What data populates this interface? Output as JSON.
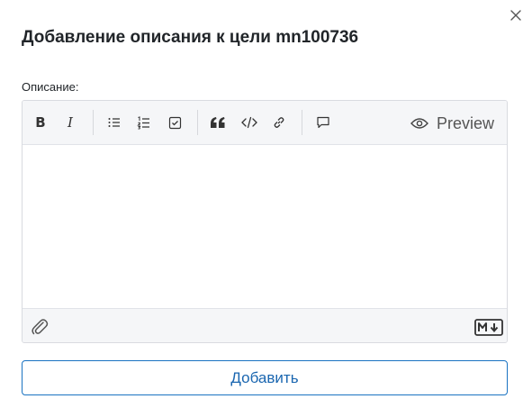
{
  "dialog": {
    "title": "Добавление описания к цели mn100736",
    "description_label": "Описание:",
    "description_value": "",
    "description_placeholder": "",
    "submit_label": "Добавить"
  },
  "toolbar": {
    "bold_glyph": "B",
    "italic_glyph": "I",
    "preview_label": "Preview",
    "icons": [
      "bold-icon",
      "italic-icon",
      "bullet-list-icon",
      "numbered-list-icon",
      "checklist-icon",
      "quote-icon",
      "code-icon",
      "link-icon",
      "comment-icon",
      "eye-icon"
    ]
  },
  "footer": {
    "icons": [
      "paperclip-icon",
      "markdown-icon"
    ]
  },
  "colors": {
    "primary": "#1a73c2",
    "toolbar_bg": "#f5f6f8",
    "border": "#d9dbe0"
  }
}
